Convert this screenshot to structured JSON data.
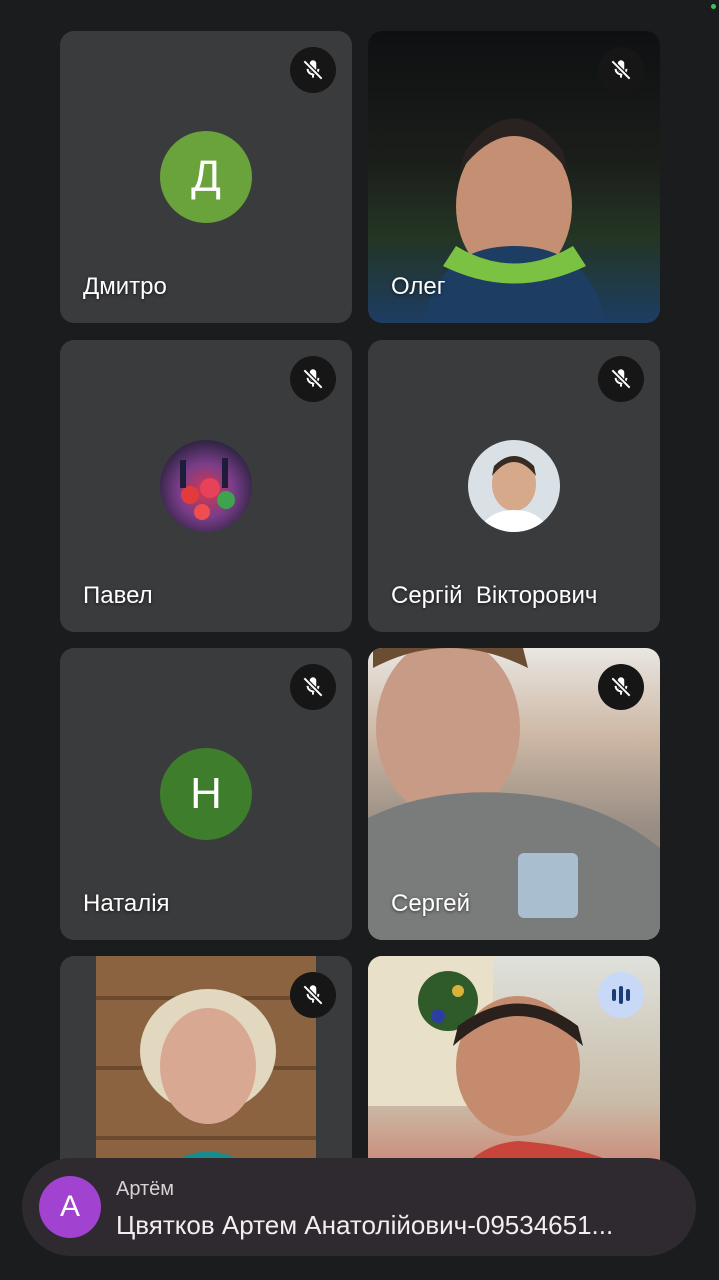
{
  "participants": [
    {
      "name": "Дмитро",
      "initial": "Д",
      "avatar_color": "#6aa23b",
      "muted": true
    },
    {
      "name": "Олег",
      "muted": true
    },
    {
      "name": "Павел",
      "muted": true
    },
    {
      "name": "Сергій  Вікторович",
      "muted": true
    },
    {
      "name": "Наталія",
      "initial": "Н",
      "avatar_color": "#3d7d2b",
      "muted": true
    },
    {
      "name": "Сергей",
      "muted": true
    },
    {
      "name": "",
      "muted": true
    },
    {
      "name": "",
      "muted": false,
      "speaking": true
    }
  ],
  "notification": {
    "sender": "Артём",
    "sender_initial": "А",
    "avatar_color": "#a142d0",
    "message": "Цвятков Артем Анатолійович-09534651..."
  }
}
